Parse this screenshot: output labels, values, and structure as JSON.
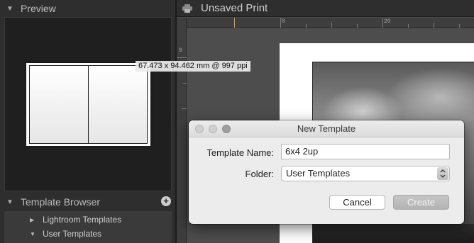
{
  "left_panel": {
    "preview_header": "Preview",
    "template_browser_header": "Template Browser",
    "template_browser_items": [
      {
        "label": "Lightroom Templates",
        "expanded": false
      },
      {
        "label": "User Templates",
        "expanded": true
      }
    ]
  },
  "main": {
    "doc_title": "Unsaved Print",
    "ruler_top_labels": [
      "0",
      "20"
    ],
    "ruler_left_labels": [
      "0"
    ],
    "photo_dimensions_label": "67.473 x 94.462 mm @ 997 ppi"
  },
  "dialog": {
    "title": "New Template",
    "template_name_label": "Template Name:",
    "template_name_value": "6x4 2up",
    "folder_label": "Folder:",
    "folder_value": "User Templates",
    "cancel_label": "Cancel",
    "create_label": "Create"
  },
  "icons": {
    "collapse": "triangle-down-icon",
    "expand": "triangle-right-icon",
    "add": "plus-icon",
    "print": "printer-icon"
  }
}
